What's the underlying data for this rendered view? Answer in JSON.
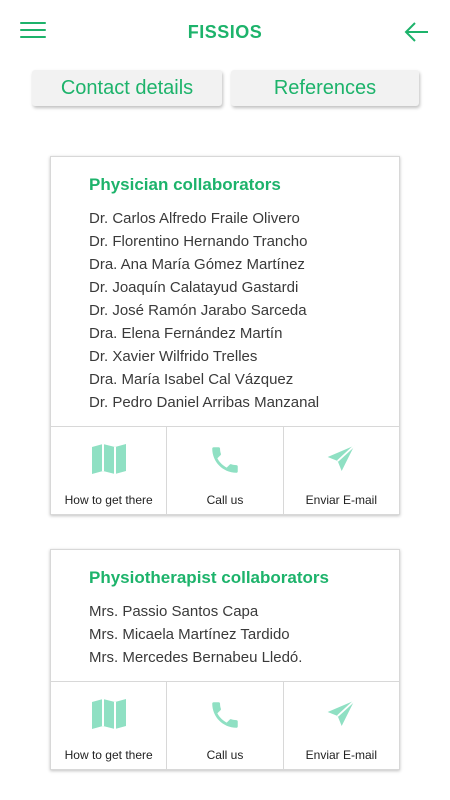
{
  "header": {
    "title": "FISSIOS",
    "menu_icon": "hamburger-menu-icon",
    "back_icon": "arrow-left-icon"
  },
  "tabs": [
    {
      "label": "Contact details"
    },
    {
      "label": "References"
    }
  ],
  "colors": {
    "accent": "#1db36b",
    "icon_tint": "#8fe0c3",
    "text": "#3a3a3a",
    "tab_bg": "#f2f2f2"
  },
  "cards": [
    {
      "title": "Physician collaborators",
      "names": [
        "Dr. Carlos Alfredo Fraile Olivero",
        "Dr. Florentino Hernando Trancho",
        "Dra. Ana María Gómez Martínez",
        "Dr. Joaquín Calatayud Gastardi",
        "Dr. José Ramón Jarabo Sarceda",
        "Dra. Elena Fernández Martín",
        "Dr. Xavier Wilfrido Trelles",
        "Dra. María Isabel Cal Vázquez",
        "Dr. Pedro Daniel Arribas Manzanal"
      ],
      "actions": [
        {
          "label": "How to get there",
          "icon": "map-icon"
        },
        {
          "label": "Call us",
          "icon": "phone-icon"
        },
        {
          "label": "Enviar E-mail",
          "icon": "send-icon"
        }
      ]
    },
    {
      "title": "Physiotherapist collaborators",
      "names": [
        "Mrs. Passio Santos Capa",
        "Mrs. Micaela Martínez Tardido",
        "Mrs. Mercedes Bernabeu Lledó."
      ],
      "actions": [
        {
          "label": "How to get there",
          "icon": "map-icon"
        },
        {
          "label": "Call us",
          "icon": "phone-icon"
        },
        {
          "label": "Enviar E-mail",
          "icon": "send-icon"
        }
      ]
    }
  ]
}
